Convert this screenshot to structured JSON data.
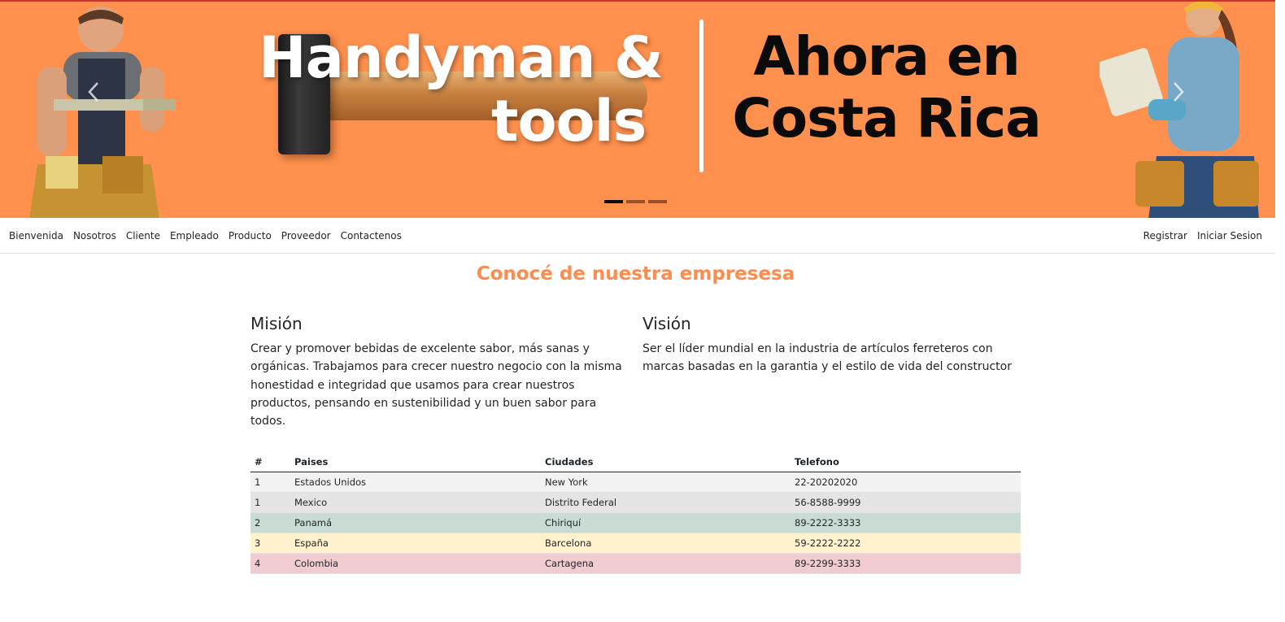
{
  "banner": {
    "brand_line1": "Handyman &",
    "brand_line2": "tools",
    "headline_line1": "Ahora en",
    "headline_line2": "Costa Rica",
    "indicators": [
      {
        "active": true
      },
      {
        "active": false
      },
      {
        "active": false
      }
    ],
    "colors": {
      "background": "#ff904d",
      "top_border": "#c8352a"
    }
  },
  "nav": {
    "left": [
      "Bienvenida",
      "Nosotros",
      "Cliente",
      "Empleado",
      "Producto",
      "Proveedor",
      "Contactenos"
    ],
    "right": [
      "Registrar",
      "Iniciar Sesion"
    ]
  },
  "main": {
    "title": "Conocé de nuestra empresesa",
    "title_color": "#ff8c4e",
    "mision": {
      "heading": "Misión",
      "text": "Crear y promover bebidas de excelente sabor, más sanas y orgánicas. Trabajamos para crecer nuestro negocio con la misma honestidad e integridad que usamos para crear nuestros productos, pensando en sustenibilidad y un buen sabor para todos."
    },
    "vision": {
      "heading": "Visión",
      "text": "Ser el líder mundial en la industria de artículos ferreteros con marcas basadas en la garantia y el estilo de vida del constructor"
    }
  },
  "table": {
    "headers": [
      "#",
      "Paises",
      "Ciudades",
      "Telefono"
    ],
    "rows": [
      {
        "num": "1",
        "pais": "Estados Unidos",
        "ciudad": "New York",
        "telefono": "22-20202020",
        "style": "light"
      },
      {
        "num": "1",
        "pais": "Mexico",
        "ciudad": "Distrito Federal",
        "telefono": "56-8588-9999",
        "style": "secondary"
      },
      {
        "num": "2",
        "pais": "Panamá",
        "ciudad": "Chiriquí",
        "telefono": "89-2222-3333",
        "style": "success"
      },
      {
        "num": "3",
        "pais": "España",
        "ciudad": "Barcelona",
        "telefono": "59-2222-2222",
        "style": "warning"
      },
      {
        "num": "4",
        "pais": "Colombia",
        "ciudad": "Cartagena",
        "telefono": "89-2299-3333",
        "style": "danger"
      }
    ]
  }
}
